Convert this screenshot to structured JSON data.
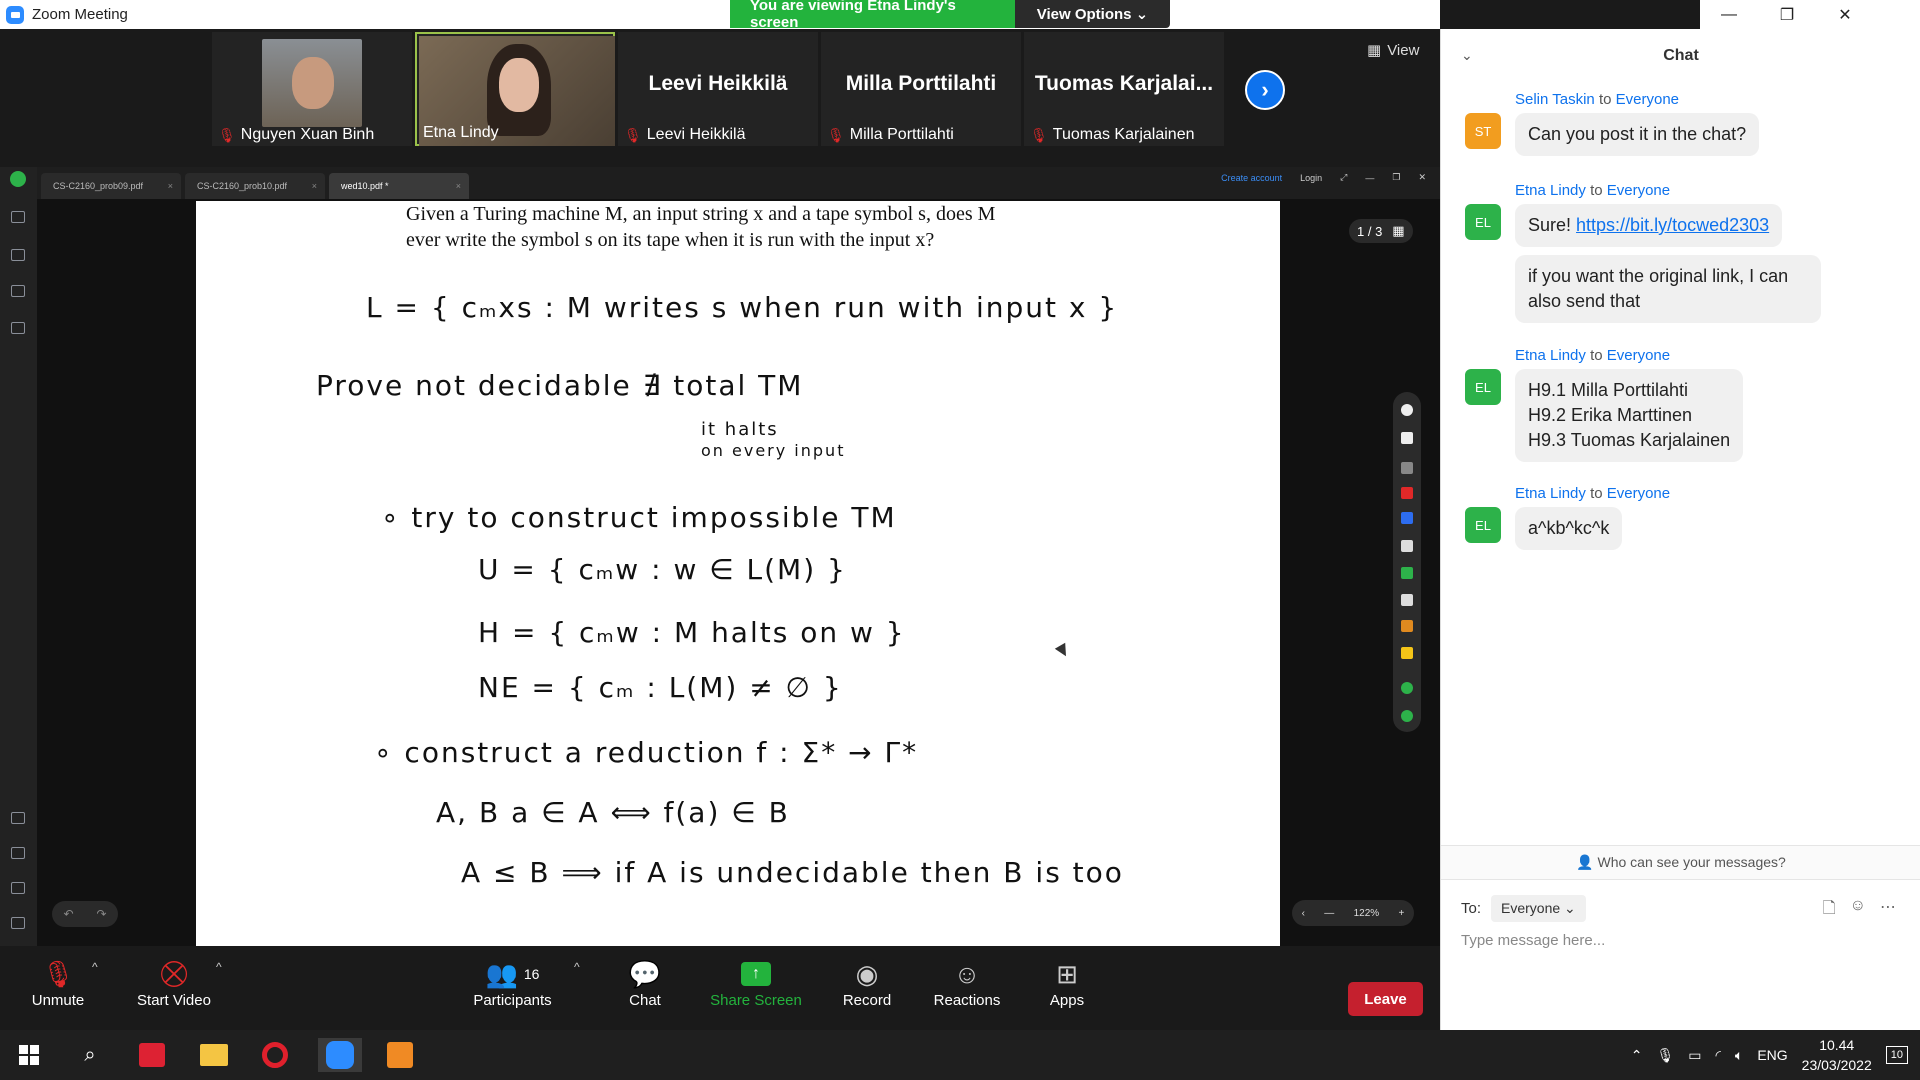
{
  "window": {
    "title": "Zoom Meeting",
    "minimize": "—",
    "maximize": "❐",
    "close": "✕"
  },
  "banner": {
    "viewing": "You are viewing Etna Lindy's screen",
    "view_options": "View Options ⌄"
  },
  "gallery": {
    "view_label": "View",
    "participants": [
      {
        "name": "Nguyen Xuan Binh",
        "muted": true,
        "video": true
      },
      {
        "name": "Etna Lindy",
        "muted": false,
        "video": true
      },
      {
        "name": "Leevi Heikkilä",
        "display": "Leevi Heikkilä",
        "muted": true
      },
      {
        "name": "Milla Porttilahti",
        "display": "Milla Porttilahti",
        "muted": true
      },
      {
        "name": "Tuomas Karjalainen",
        "display": "Tuomas  Karjalai...",
        "muted": true
      }
    ],
    "next_icon": "›"
  },
  "pdf": {
    "tabs": [
      {
        "label": "CS-C2160_prob09.pdf"
      },
      {
        "label": "CS-C2160_prob10.pdf"
      },
      {
        "label": "wed10.pdf *"
      }
    ],
    "create_account": "Create account",
    "login": "Login",
    "page_indicator": "1 / 3",
    "zoom_level": "122%",
    "printed_text": "Given a Turing machine M, an input string x and a tape symbol s, does M ever write the symbol s on its tape when it is run with the input x?",
    "handwriting": [
      "L = { cₘxs  :  M writes s when run with input x }",
      "Prove  not  decidable       ∄ total TM",
      "it halts",
      "on every input",
      "∘  try  to  construct  impossible  TM",
      "U = { cₘw  :  w ∈ L(M) }",
      "H = { cₘw  :  M halts on w }",
      "NE = { cₘ  :  L(M) ≠ ∅ }",
      "∘  construct  a  reduction        f : Σ* → Γ*",
      "A, B              a ∈ A  ⟺  f(a) ∈ B",
      "A ≤ B  ⟹  if A is undecidable then B is too"
    ]
  },
  "toolbar": {
    "unmute": "Unmute",
    "start_video": "Start Video",
    "participants": "Participants",
    "participants_count": "16",
    "chat": "Chat",
    "share_screen": "Share Screen",
    "record": "Record",
    "reactions": "Reactions",
    "apps": "Apps",
    "leave": "Leave"
  },
  "chat": {
    "title": "Chat",
    "to_word": "to",
    "messages": [
      {
        "from": "Selin Taskin",
        "to": "Everyone",
        "initials": "ST",
        "color": "#f29d1f",
        "lines": [
          "Can you post it in the chat?"
        ]
      },
      {
        "from": "Etna Lindy",
        "to": "Everyone",
        "initials": "EL",
        "color": "#2db24a",
        "prefix": "Sure! ",
        "link": "https://bit.ly/tocwed2303",
        "second": "if you want the original link, I can also send that"
      },
      {
        "from": "Etna Lindy",
        "to": "Everyone",
        "initials": "EL",
        "color": "#2db24a",
        "lines": [
          "H9.1 Milla Porttilahti",
          "H9.2 Erika Marttinen",
          "H9.3 Tuomas Karjalainen"
        ]
      },
      {
        "from": "Etna Lindy",
        "to": "Everyone",
        "initials": "EL",
        "color": "#2db24a",
        "lines": [
          "a^kb^kc^k"
        ]
      }
    ],
    "who_can_see": "Who can see your messages?",
    "to_label": "To:",
    "to_value": "Everyone",
    "input_placeholder": "Type message here..."
  },
  "taskbar": {
    "language": "ENG",
    "time": "10.44",
    "date": "23/03/2022",
    "notifications": "10"
  }
}
